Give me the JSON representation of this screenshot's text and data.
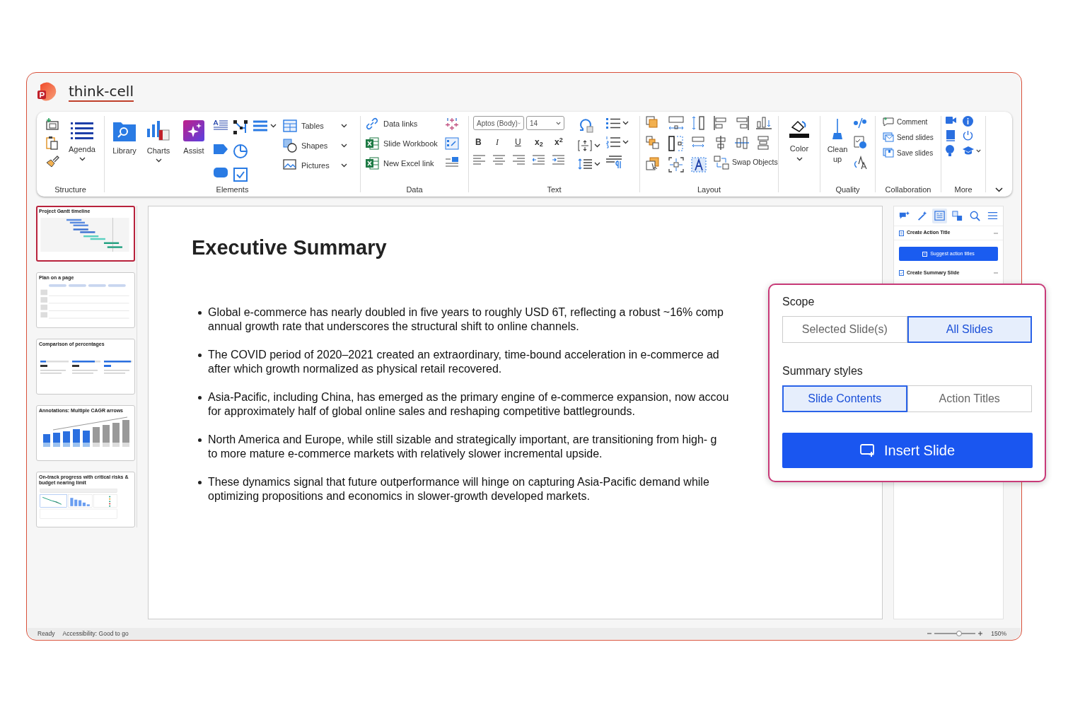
{
  "app": {
    "title": "think-cell"
  },
  "ribbon": {
    "groups": [
      {
        "label": "Structure",
        "buttons": [
          {
            "label": "Agenda"
          }
        ]
      },
      {
        "label": "Elements",
        "buttons": [
          {
            "label": "Library"
          },
          {
            "label": "Charts"
          },
          {
            "label": "Assist"
          },
          {
            "label": "Tables"
          },
          {
            "label": "Shapes"
          },
          {
            "label": "Pictures"
          }
        ]
      },
      {
        "label": "Data",
        "buttons": [
          {
            "label": "Data links"
          },
          {
            "label": "Slide Workbook"
          },
          {
            "label": "New Excel link"
          }
        ]
      },
      {
        "label": "Text",
        "font": "Aptos (Body)",
        "size": "14",
        "buttons": [
          {
            "label": "B"
          },
          {
            "label": "I"
          },
          {
            "label": "U"
          },
          {
            "label": "x$_{2}$"
          },
          {
            "label": "x$^{2}$"
          }
        ]
      },
      {
        "label": "Layout",
        "buttons": [
          {
            "label": "Swap Objects"
          }
        ]
      },
      {
        "buttons": [
          {
            "label": "Color"
          }
        ]
      },
      {
        "label": "Quality",
        "buttons": [
          {
            "label": "Clean up"
          }
        ]
      },
      {
        "label": "Collaboration",
        "buttons": [
          {
            "label": "Comment"
          },
          {
            "label": "Send slides"
          },
          {
            "label": "Save slides"
          }
        ]
      },
      {
        "label": "More"
      }
    ]
  },
  "thumbnails": [
    {
      "kind": "gantt",
      "title": "Project Gantt timeline",
      "selected": true
    },
    {
      "kind": "table",
      "title": "Plan on a page",
      "selected": false
    },
    {
      "kind": "percent",
      "title": "Comparison of percentages",
      "selected": false
    },
    {
      "kind": "bars",
      "title": "Annotations: Multiple CAGR arrows",
      "selected": false
    },
    {
      "kind": "dashboard",
      "title": "On-track progress with critical risks & budget nearing limit",
      "selected": false
    }
  ],
  "slide": {
    "title": "Executive Summary",
    "bullets": [
      {
        "lines": [
          "Global e-commerce has nearly doubled in five years to roughly USD 6T, reflecting a robust ~16% comp",
          "annual growth rate that underscores the structural shift to online channels."
        ]
      },
      {
        "lines": [
          "The COVID period of 2020–2021 created an extraordinary, time-bound acceleration in e-commerce ad",
          "after which growth normalized as physical retail recovered."
        ]
      },
      {
        "lines": [
          "Asia-Pacific, including China, has emerged as the primary engine of e-commerce expansion, now accou",
          "for approximately half of global online sales and reshaping competitive battlegrounds."
        ]
      },
      {
        "lines": [
          "North America and Europe, while still sizable and strategically important, are transitioning from high- g",
          "to more mature e-commerce markets with relatively slower incremental upside."
        ]
      },
      {
        "lines": [
          "These dynamics signal that future outperformance will hinge on capturing Asia-Pacific demand while",
          "optimizing propositions and economics in slower-growth developed markets."
        ]
      }
    ]
  },
  "side_panel": {
    "tools": [
      {
        "selected": false
      },
      {
        "selected": false
      },
      {
        "selected": true
      },
      {
        "selected": false
      },
      {
        "selected": false
      },
      {
        "selected": false
      }
    ],
    "sections": [
      {
        "title": "Create Action Title",
        "button": "Suggest action titles"
      },
      {
        "title": "Create Summary Slide"
      }
    ]
  },
  "summary_popup": {
    "scope_label": "Scope",
    "scope_options": [
      {
        "label": "Selected Slide(s)",
        "selected": false
      },
      {
        "label": "All Slides",
        "selected": true
      }
    ],
    "styles_label": "Summary styles",
    "style_options": [
      {
        "label": "Slide Contents",
        "selected": true
      },
      {
        "label": "Action Titles",
        "selected": false
      }
    ],
    "insert_button": "Insert Slide"
  },
  "status_bar": {
    "status": "Ready",
    "accessibility": "Accessibility: Good to go",
    "zoom": {
      "level": 0.6,
      "reading": "150%"
    }
  }
}
